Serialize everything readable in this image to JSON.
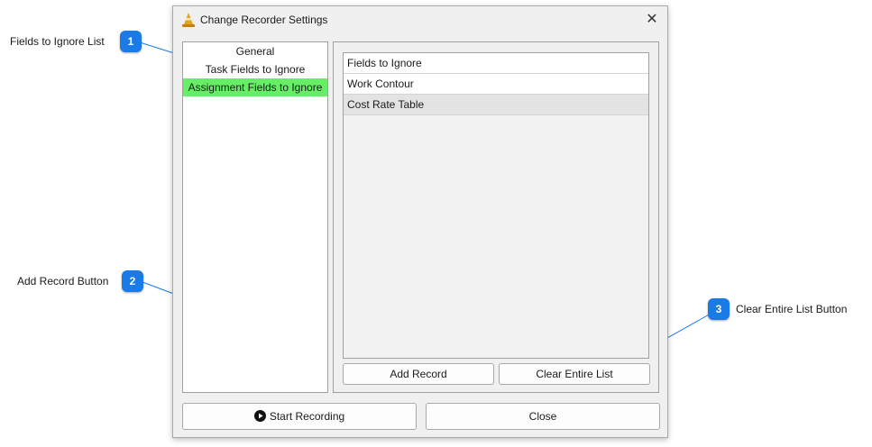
{
  "window": {
    "title": "Change Recorder Settings",
    "close_glyph": "✕"
  },
  "left_list": {
    "items": [
      {
        "label": "General",
        "selected": false
      },
      {
        "label": "Task Fields to Ignore",
        "selected": false
      },
      {
        "label": "Assignment Fields to Ignore",
        "selected": true
      }
    ]
  },
  "fields_list": {
    "header": "Fields to Ignore",
    "rows": [
      "Work Contour",
      "Cost Rate Table"
    ]
  },
  "buttons": {
    "add_record": "Add Record",
    "clear_list": "Clear Entire List",
    "start_recording": "Start Recording",
    "close": "Close"
  },
  "callouts": [
    {
      "number": "1",
      "label": "Fields to Ignore List"
    },
    {
      "number": "2",
      "label": "Add Record Button"
    },
    {
      "number": "3",
      "label": "Clear Entire List Button"
    }
  ],
  "colors": {
    "selected_item": "#66ee66",
    "callout": "#1a7ae6",
    "callout_line": "#1a7ae6"
  },
  "icons": {
    "app": "traffic-cone-icon",
    "start": "play-circle-icon"
  }
}
